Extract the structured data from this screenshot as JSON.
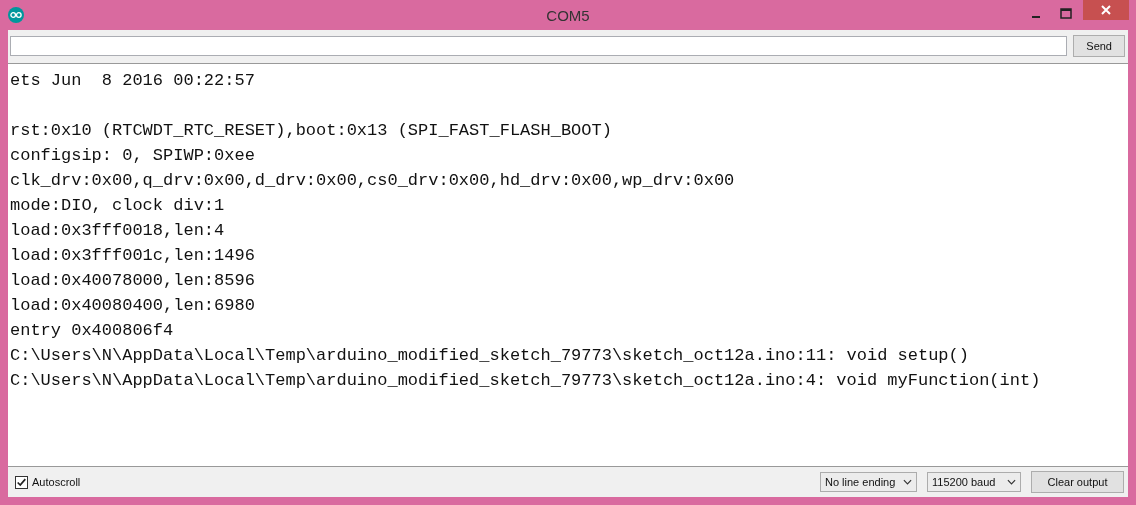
{
  "window": {
    "title": "COM5"
  },
  "send_button": "Send",
  "output_blocks": [
    [
      "ets Jun  8 2016 00:22:57"
    ],
    [
      "rst:0x10 (RTCWDT_RTC_RESET),boot:0x13 (SPI_FAST_FLASH_BOOT)",
      "configsip: 0, SPIWP:0xee",
      "clk_drv:0x00,q_drv:0x00,d_drv:0x00,cs0_drv:0x00,hd_drv:0x00,wp_drv:0x00",
      "mode:DIO, clock div:1",
      "load:0x3fff0018,len:4",
      "load:0x3fff001c,len:1496",
      "load:0x40078000,len:8596",
      "load:0x40080400,len:6980",
      "entry 0x400806f4",
      "C:\\Users\\N\\AppData\\Local\\Temp\\arduino_modified_sketch_79773\\sketch_oct12a.ino:11: void setup()",
      "C:\\Users\\N\\AppData\\Local\\Temp\\arduino_modified_sketch_79773\\sketch_oct12a.ino:4: void myFunction(int)"
    ]
  ],
  "autoscroll": {
    "label": "Autoscroll",
    "checked": true
  },
  "line_ending": "No line ending",
  "baud": "115200 baud",
  "clear_button": "Clear output"
}
